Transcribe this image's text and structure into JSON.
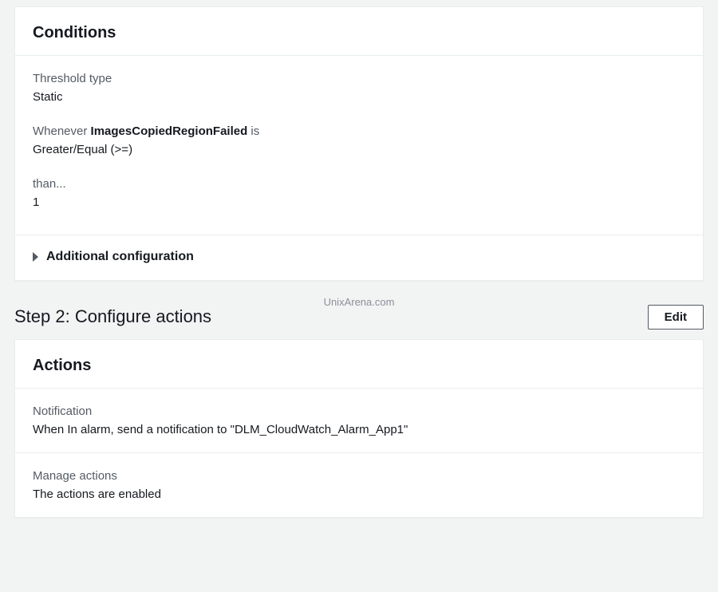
{
  "conditions": {
    "title": "Conditions",
    "threshold_label": "Threshold type",
    "threshold_value": "Static",
    "whenever_prefix": "Whenever ",
    "metric_name": "ImagesCopiedRegionFailed",
    "whenever_suffix": " is",
    "comparison_value": "Greater/Equal (>=)",
    "than_label": "than...",
    "than_value": "1",
    "additional_config": "Additional configuration"
  },
  "watermark": "UnixArena.com",
  "step2": {
    "title": "Step 2: Configure actions",
    "edit_label": "Edit"
  },
  "actions": {
    "title": "Actions",
    "notification_label": "Notification",
    "notification_value": "When In alarm, send a notification to \"DLM_CloudWatch_Alarm_App1\"",
    "manage_label": "Manage actions",
    "manage_value": "The actions are enabled"
  }
}
